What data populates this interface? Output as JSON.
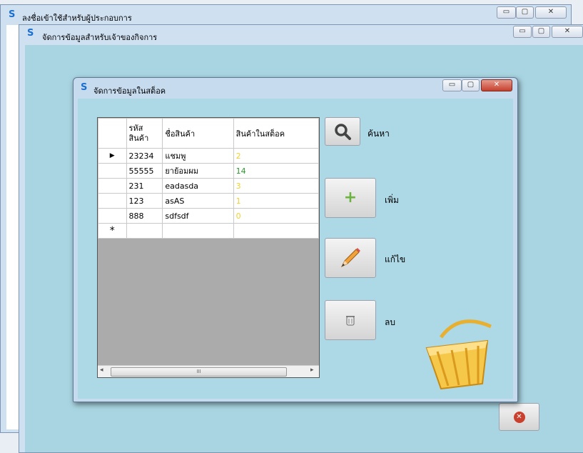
{
  "windows": {
    "login": {
      "title": "ลงชื่อเข้าใช้สำหรับผู้ประกอบการ"
    },
    "owner": {
      "title": "จัดการข้อมูลสำหรับเจ้าของกิจการ"
    },
    "stock": {
      "title": "จัดการข้อมูลในสต็อค"
    }
  },
  "grid": {
    "columns": [
      "รหัส\nสินค้า",
      "ชื่อสินค้า",
      "สินค้าในสต็อค"
    ],
    "rows": [
      {
        "code": "23234",
        "name": "แชมพู",
        "qty": "2",
        "qty_color": "#f0d030"
      },
      {
        "code": "55555",
        "name": "ยาย้อมผม",
        "qty": "14",
        "qty_color": "#2a9a2a"
      },
      {
        "code": "231",
        "name": "eadasda",
        "qty": "3",
        "qty_color": "#f0d030"
      },
      {
        "code": "123",
        "name": "asAS",
        "qty": "1",
        "qty_color": "#f0d030"
      },
      {
        "code": "888",
        "name": "sdfsdf",
        "qty": "0",
        "qty_color": "#f0d030"
      }
    ],
    "current_row_marker": "▶",
    "new_row_marker": "*",
    "hscroll_thumb": "III"
  },
  "actions": {
    "search_label": "ค้นหา",
    "add_label": "เพิ่ม",
    "edit_label": "แก้ไข",
    "delete_label": "ลบ"
  },
  "caption_buttons": {
    "min": "▭",
    "max": "▢",
    "close": "✕"
  },
  "colors": {
    "client_bg": "#a9d5e2",
    "inner_bg": "#add8e6",
    "close_red": "#c9402e"
  }
}
